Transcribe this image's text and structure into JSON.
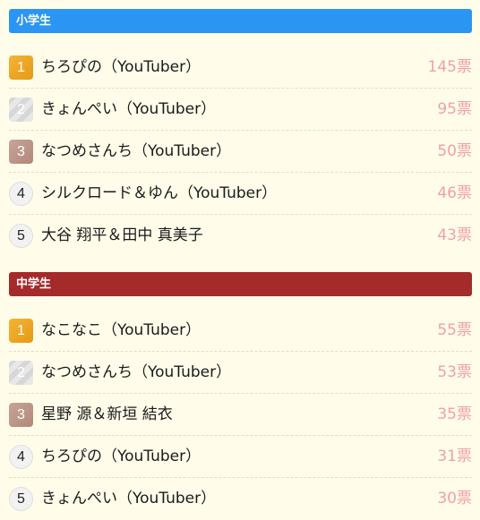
{
  "colors": {
    "background": "#fffdea",
    "elementary_header": "#2b95f3",
    "junior_header": "#a52a2a",
    "votes_text": "#f0a0a6",
    "gold": "#e9a224",
    "silver": "#d9d9d9",
    "bronze": "#bb978a"
  },
  "sections": [
    {
      "title": "小学生",
      "rankings": [
        {
          "rank": "1",
          "name": "ちろぴの（YouTuber）",
          "votes": "145票"
        },
        {
          "rank": "2",
          "name": "きょんぺい（YouTuber）",
          "votes": "95票"
        },
        {
          "rank": "3",
          "name": "なつめさんち（YouTuber）",
          "votes": "50票"
        },
        {
          "rank": "4",
          "name": "シルクロード＆ゆん（YouTuber）",
          "votes": "46票"
        },
        {
          "rank": "5",
          "name": "大谷 翔平＆田中 真美子",
          "votes": "43票"
        }
      ]
    },
    {
      "title": "中学生",
      "rankings": [
        {
          "rank": "1",
          "name": "なこなこ（YouTuber）",
          "votes": "55票"
        },
        {
          "rank": "2",
          "name": "なつめさんち（YouTuber）",
          "votes": "53票"
        },
        {
          "rank": "3",
          "name": "星野 源＆新垣 結衣",
          "votes": "35票"
        },
        {
          "rank": "4",
          "name": "ちろぴの（YouTuber）",
          "votes": "31票"
        },
        {
          "rank": "5",
          "name": "きょんぺい（YouTuber）",
          "votes": "30票"
        }
      ]
    }
  ]
}
